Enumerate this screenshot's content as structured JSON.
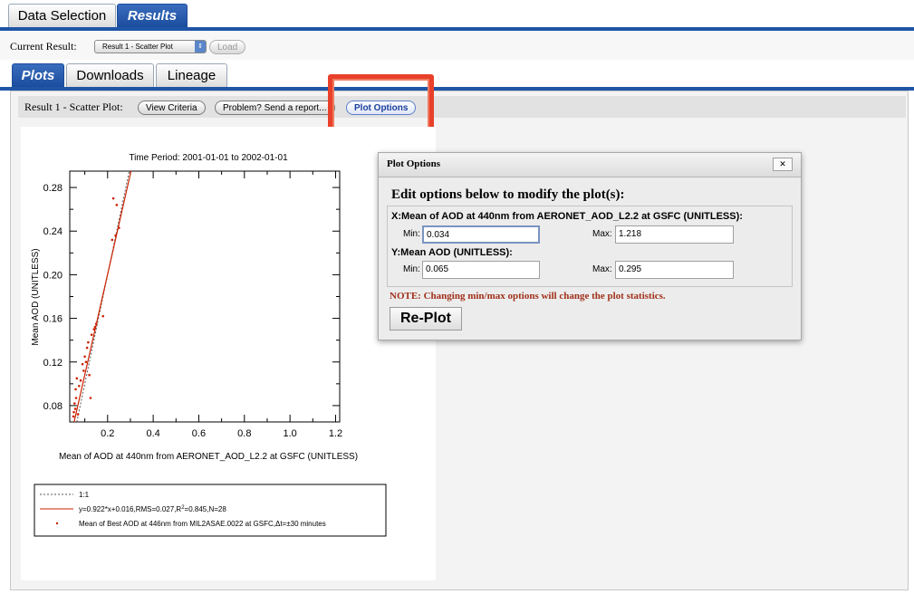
{
  "tabs": {
    "data_selection": "Data Selection",
    "results": "Results"
  },
  "current_result": {
    "label": "Current Result:",
    "select_value": "Result 1 - Scatter Plot",
    "load_label": "Load"
  },
  "subtabs": {
    "plots": "Plots",
    "downloads": "Downloads",
    "lineage": "Lineage"
  },
  "toolbar": {
    "result_label": "Result 1 - Scatter Plot:",
    "view_criteria": "View Criteria",
    "report": "Problem? Send a report...",
    "plot_options": "Plot Options"
  },
  "chart_data": {
    "type": "scatter",
    "title": "Time Period: 2001-01-01 to 2002-01-01",
    "xlabel": "Mean of AOD at  440nm from AERONET_AOD_L2.2 at GSFC (UNITLESS)",
    "ylabel": "Mean AOD (UNITLESS)",
    "xlim": [
      0.034,
      1.218
    ],
    "ylim": [
      0.065,
      0.295
    ],
    "x_ticks": [
      "0.2",
      "0.4",
      "0.6",
      "0.8",
      "1.0",
      "1.2"
    ],
    "y_ticks": [
      "0.08",
      "0.12",
      "0.16",
      "0.20",
      "0.24",
      "0.28"
    ],
    "points": [
      [
        0.05,
        0.07
      ],
      [
        0.052,
        0.074
      ],
      [
        0.055,
        0.082
      ],
      [
        0.058,
        0.077
      ],
      [
        0.06,
        0.095
      ],
      [
        0.062,
        0.087
      ],
      [
        0.065,
        0.105
      ],
      [
        0.07,
        0.072
      ],
      [
        0.075,
        0.098
      ],
      [
        0.082,
        0.103
      ],
      [
        0.09,
        0.118
      ],
      [
        0.095,
        0.112
      ],
      [
        0.1,
        0.125
      ],
      [
        0.105,
        0.12
      ],
      [
        0.11,
        0.133
      ],
      [
        0.115,
        0.138
      ],
      [
        0.12,
        0.108
      ],
      [
        0.125,
        0.087
      ],
      [
        0.13,
        0.145
      ],
      [
        0.14,
        0.15
      ],
      [
        0.145,
        0.152
      ],
      [
        0.15,
        0.155
      ],
      [
        0.18,
        0.162
      ],
      [
        0.22,
        0.232
      ],
      [
        0.225,
        0.27
      ],
      [
        0.235,
        0.236
      ],
      [
        0.24,
        0.264
      ],
      [
        0.25,
        0.243
      ]
    ],
    "fit": {
      "slope": 0.922,
      "intercept": 0.016
    },
    "legend": {
      "one_to_one": "1:1",
      "fit_pre": "y=0.922*x+0.016,RMS=0.027,R",
      "fit_sup": "2",
      "fit_post": "=0.845,N=28",
      "points": "Mean of Best AOD at 446nm from MIL2ASAE.0022 at GSFC,Δt=±30 minutes"
    },
    "colors": {
      "points": "#cc2200",
      "fit": "#cc2200",
      "one_to_one": "#555555"
    }
  },
  "dialog": {
    "title": "Plot Options",
    "close": "✕",
    "heading": "Edit options below to modify the plot(s):",
    "x_title": "X:Mean of AOD at 440nm from AERONET_AOD_L2.2 at GSFC (UNITLESS):",
    "y_title": "Y:Mean AOD (UNITLESS):",
    "min_label": "Min:",
    "max_label": "Max:",
    "x_min": "0.034",
    "x_max": "1.218",
    "y_min": "0.065",
    "y_max": "0.295",
    "note": "NOTE: Changing min/max options will change the plot statistics.",
    "replot": "Re-Plot"
  },
  "colors": {
    "tab_blue": "#1f55a6",
    "highlight_red": "#e8402a",
    "note_red": "#a0301a"
  }
}
